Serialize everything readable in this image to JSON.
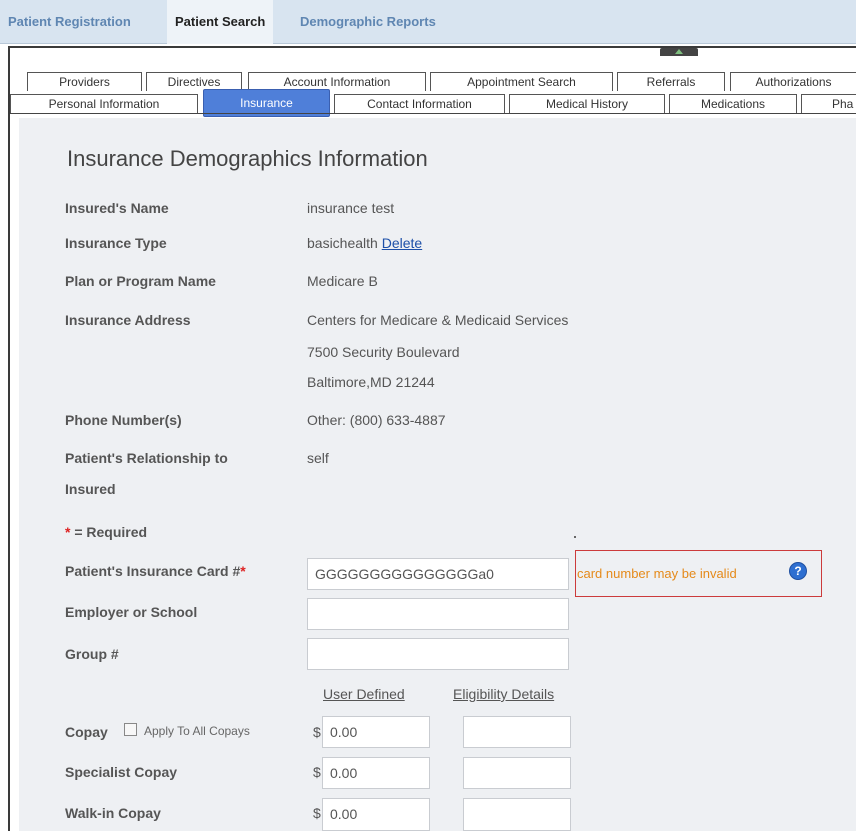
{
  "topnav": {
    "registration": "Patient Registration",
    "search": "Patient Search",
    "reports": "Demographic Reports"
  },
  "tabs": {
    "row1": [
      "Providers",
      "Directives",
      "Account Information",
      "Appointment Search",
      "Referrals",
      "Authorizations"
    ],
    "row2": [
      "Personal Information",
      "Insurance",
      "Contact Information",
      "Medical History",
      "Medications",
      "Pha"
    ]
  },
  "heading": "Insurance Demographics Information",
  "fields": {
    "insured_name_label": "Insured's Name",
    "insured_name": "insurance test",
    "insurance_type_label": "Insurance Type",
    "insurance_type": "basichealth",
    "delete_link": "Delete",
    "plan_label": "Plan or Program Name",
    "plan": "Medicare B",
    "address_label": "Insurance Address",
    "address_line1": "Centers for Medicare & Medicaid Services",
    "address_line2": "7500 Security Boulevard",
    "address_line3": "Baltimore,MD 21244",
    "phone_label": "Phone Number(s)",
    "phone": "Other: (800) 633-4887",
    "relationship_label_1": "Patient's Relationship to",
    "relationship_label_2": "Insured",
    "relationship": "self"
  },
  "required_note": "= Required",
  "form": {
    "card_label": "Patient's Insurance Card #",
    "card_value": "GGGGGGGGGGGGGGGa0",
    "card_warning": "card number may be invalid",
    "employer_label": "Employer or School",
    "employer_value": "",
    "group_label": "Group #",
    "group_value": "",
    "col_user_defined": "User Defined",
    "col_eligibility": "Eligibility Details",
    "copay_label": "Copay",
    "apply_all_label": "Apply To All Copays",
    "copay_value": "0.00",
    "specialist_label": "Specialist Copay",
    "specialist_value": "0.00",
    "walkin_label": "Walk-in Copay",
    "walkin_value": "0.00",
    "currency": "$"
  }
}
